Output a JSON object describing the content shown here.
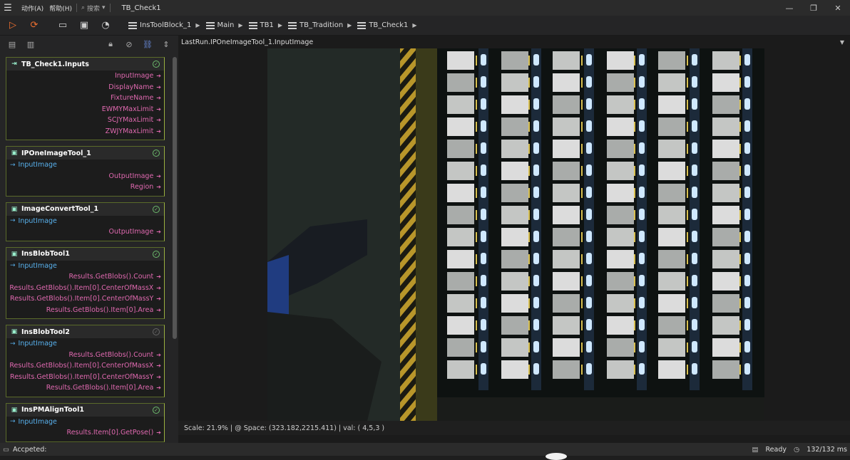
{
  "titlebar": {
    "menu_action": "动作(A)",
    "menu_help": "帮助(H)",
    "search_label": "搜索",
    "window_title": "TB_Check1"
  },
  "breadcrumb": [
    "InsToolBlock_1",
    "Main",
    "TB1",
    "TB_Tradition",
    "TB_Check1"
  ],
  "blocks": [
    {
      "title": "TB_Check1.Inputs",
      "status": "ok",
      "inputs": [],
      "outputs": [
        "InputImage",
        "DisplayName",
        "FixtureName",
        "EWMYMaxLimit",
        "SCJYMaxLimit",
        "ZWJYMaxLimit"
      ]
    },
    {
      "title": "IPOneImageTool_1",
      "status": "ok",
      "inputs": [
        "InputImage"
      ],
      "outputs": [
        "OutputImage",
        "Region"
      ]
    },
    {
      "title": "ImageConvertTool_1",
      "status": "ok",
      "inputs": [
        "InputImage"
      ],
      "outputs": [
        "OutputImage"
      ]
    },
    {
      "title": "InsBlobTool1",
      "status": "ok",
      "inputs": [
        "InputImage"
      ],
      "outputs": [
        "Results.GetBlobs().Count",
        "Results.GetBlobs().Item[0].CenterOfMassX",
        "Results.GetBlobs().Item[0].CenterOfMassY",
        "Results.GetBlobs().Item[0].Area"
      ]
    },
    {
      "title": "InsBlobTool2",
      "status": "dim",
      "inputs": [
        "InputImage"
      ],
      "outputs": [
        "Results.GetBlobs().Count",
        "Results.GetBlobs().Item[0].CenterOfMassX",
        "Results.GetBlobs().Item[0].CenterOfMassY",
        "Results.GetBlobs().Item[0].Area"
      ]
    },
    {
      "title": "InsPMAlignTool1",
      "status": "ok",
      "inputs": [
        "InputImage"
      ],
      "outputs": [
        "Results.Item[0].GetPose()"
      ]
    }
  ],
  "viewer": {
    "header": "LastRun.IPOneImageTool_1.InputImage",
    "status": "Scale: 21.9%  | @ Space: (323.182,2215.411)  | val: ( 4,5,3 )"
  },
  "statusbar": {
    "left": "Accpeted:",
    "ready": "Ready",
    "timing": "132/132 ms"
  },
  "colors": {
    "input_pin": "#58b0ec",
    "output_pin": "#e069b0",
    "ok": "#6dbb6d",
    "run": "#f07030"
  }
}
